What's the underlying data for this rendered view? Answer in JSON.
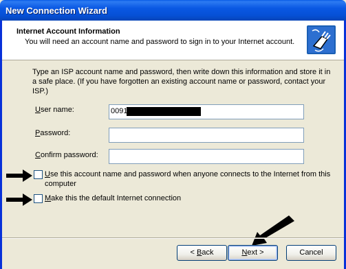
{
  "window": {
    "title": "New Connection Wizard"
  },
  "header": {
    "title": "Internet Account Information",
    "subtitle": "You will need an account name and password to sign in to your Internet account."
  },
  "intro_text": "Type an ISP account name and password, then write down this information and store it in a safe place. (If you have forgotten an existing account name or password, contact your ISP.)",
  "fields": {
    "username": {
      "label_accel": "U",
      "label_rest": "ser name:",
      "value": "0091"
    },
    "password": {
      "label_accel": "P",
      "label_rest": "assword:",
      "value": ""
    },
    "confirm": {
      "label_accel": "C",
      "label_rest": "onfirm password:",
      "value": ""
    }
  },
  "checkboxes": {
    "use_account": {
      "accel": "U",
      "rest": "se this account  name and password when anyone connects to the Internet from this computer",
      "checked": false
    },
    "default_conn": {
      "accel": "M",
      "rest": "ake this the default Internet connection",
      "checked": false
    }
  },
  "buttons": {
    "back": {
      "prefix": "< ",
      "accel": "B",
      "rest": "ack"
    },
    "next": {
      "accel": "N",
      "rest": "ext >"
    },
    "cancel": {
      "label": "Cancel"
    }
  }
}
